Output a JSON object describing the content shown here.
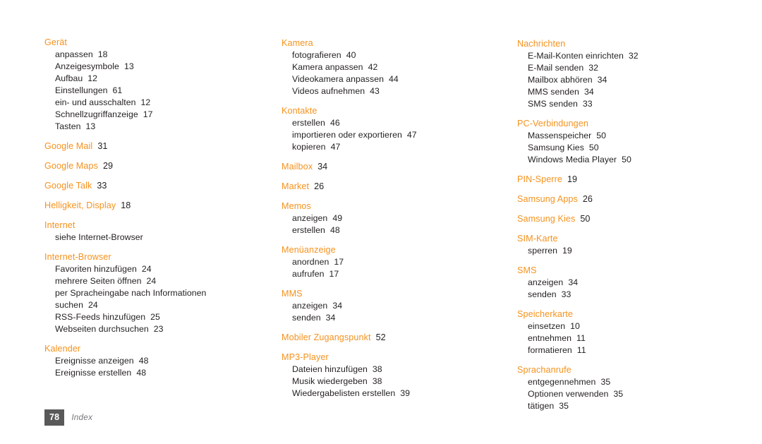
{
  "document": {
    "page_number": "78",
    "section_label": "Index",
    "accent_color": "#f5921e",
    "text_color": "#231f20",
    "badge_color": "#595959"
  },
  "columns": [
    {
      "id": "column-1",
      "groups": [
        {
          "title": "Gerät",
          "page": "",
          "items": [
            {
              "label": "anpassen",
              "page": "18"
            },
            {
              "label": "Anzeigesymbole",
              "page": "13"
            },
            {
              "label": "Aufbau",
              "page": "12"
            },
            {
              "label": "Einstellungen",
              "page": "61"
            },
            {
              "label": "ein- und ausschalten",
              "page": "12"
            },
            {
              "label": "Schnellzugriffanzeige",
              "page": "17"
            },
            {
              "label": "Tasten",
              "page": "13"
            }
          ]
        },
        {
          "title": "Google Mail",
          "page": "31",
          "items": []
        },
        {
          "title": "Google Maps",
          "page": "29",
          "items": []
        },
        {
          "title": "Google Talk",
          "page": "33",
          "items": []
        },
        {
          "title": "Helligkeit, Display",
          "page": "18",
          "items": []
        },
        {
          "title": "Internet",
          "page": "",
          "items": [
            {
              "label": "siehe Internet-Browser",
              "page": ""
            }
          ]
        },
        {
          "title": "Internet-Browser",
          "page": "",
          "items": [
            {
              "label": "Favoriten hinzufügen",
              "page": "24"
            },
            {
              "label": "mehrere Seiten öffnen",
              "page": "24"
            },
            {
              "label": "per Spracheingabe nach Informationen suchen",
              "page": "24",
              "wrap": true
            },
            {
              "label": "RSS-Feeds hinzufügen",
              "page": "25"
            },
            {
              "label": "Webseiten durchsuchen",
              "page": "23"
            }
          ]
        },
        {
          "title": "Kalender",
          "page": "",
          "items": [
            {
              "label": "Ereignisse anzeigen",
              "page": "48"
            },
            {
              "label": "Ereignisse erstellen",
              "page": "48"
            }
          ]
        }
      ]
    },
    {
      "id": "column-2",
      "groups": [
        {
          "title": "Kamera",
          "page": "",
          "items": [
            {
              "label": "fotografieren",
              "page": "40"
            },
            {
              "label": "Kamera anpassen",
              "page": "42"
            },
            {
              "label": "Videokamera anpassen",
              "page": "44"
            },
            {
              "label": "Videos aufnehmen",
              "page": "43"
            }
          ]
        },
        {
          "title": "Kontakte",
          "page": "",
          "items": [
            {
              "label": "erstellen",
              "page": "46"
            },
            {
              "label": "importieren oder exportieren",
              "page": "47"
            },
            {
              "label": "kopieren",
              "page": "47"
            }
          ]
        },
        {
          "title": "Mailbox",
          "page": "34",
          "items": []
        },
        {
          "title": "Market",
          "page": "26",
          "items": []
        },
        {
          "title": "Memos",
          "page": "",
          "items": [
            {
              "label": "anzeigen",
              "page": "49"
            },
            {
              "label": "erstellen",
              "page": "48"
            }
          ]
        },
        {
          "title": "Menüanzeige",
          "page": "",
          "items": [
            {
              "label": "anordnen",
              "page": "17"
            },
            {
              "label": "aufrufen",
              "page": "17"
            }
          ]
        },
        {
          "title": "MMS",
          "page": "",
          "items": [
            {
              "label": "anzeigen",
              "page": "34"
            },
            {
              "label": "senden",
              "page": "34"
            }
          ]
        },
        {
          "title": "Mobiler Zugangspunkt",
          "page": "52",
          "items": []
        },
        {
          "title": "MP3-Player",
          "page": "",
          "items": [
            {
              "label": "Dateien hinzufügen",
              "page": "38"
            },
            {
              "label": "Musik wiedergeben",
              "page": "38"
            },
            {
              "label": "Wiedergabelisten erstellen",
              "page": "39"
            }
          ]
        }
      ]
    },
    {
      "id": "column-3",
      "groups": [
        {
          "title": "Nachrichten",
          "page": "",
          "items": [
            {
              "label": "E-Mail-Konten einrichten",
              "page": "32"
            },
            {
              "label": "E-Mail senden",
              "page": "32"
            },
            {
              "label": "Mailbox abhören",
              "page": "34"
            },
            {
              "label": "MMS senden",
              "page": "34"
            },
            {
              "label": "SMS senden",
              "page": "33"
            }
          ]
        },
        {
          "title": "PC-Verbindungen",
          "page": "",
          "items": [
            {
              "label": "Massenspeicher",
              "page": "50"
            },
            {
              "label": "Samsung Kies",
              "page": "50"
            },
            {
              "label": "Windows Media Player",
              "page": "50"
            }
          ]
        },
        {
          "title": "PIN-Sperre",
          "page": "19",
          "items": []
        },
        {
          "title": "Samsung Apps",
          "page": "26",
          "items": []
        },
        {
          "title": "Samsung Kies",
          "page": "50",
          "items": []
        },
        {
          "title": "SIM-Karte",
          "page": "",
          "items": [
            {
              "label": "sperren",
              "page": "19"
            }
          ]
        },
        {
          "title": "SMS",
          "page": "",
          "items": [
            {
              "label": "anzeigen",
              "page": "34"
            },
            {
              "label": "senden",
              "page": "33"
            }
          ]
        },
        {
          "title": "Speicherkarte",
          "page": "",
          "items": [
            {
              "label": "einsetzen",
              "page": "10"
            },
            {
              "label": "entnehmen",
              "page": "11"
            },
            {
              "label": "formatieren",
              "page": "11"
            }
          ]
        },
        {
          "title": "Sprachanrufe",
          "page": "",
          "items": [
            {
              "label": "entgegennehmen",
              "page": "35"
            },
            {
              "label": "Optionen verwenden",
              "page": "35"
            },
            {
              "label": "tätigen",
              "page": "35"
            }
          ]
        }
      ]
    }
  ]
}
